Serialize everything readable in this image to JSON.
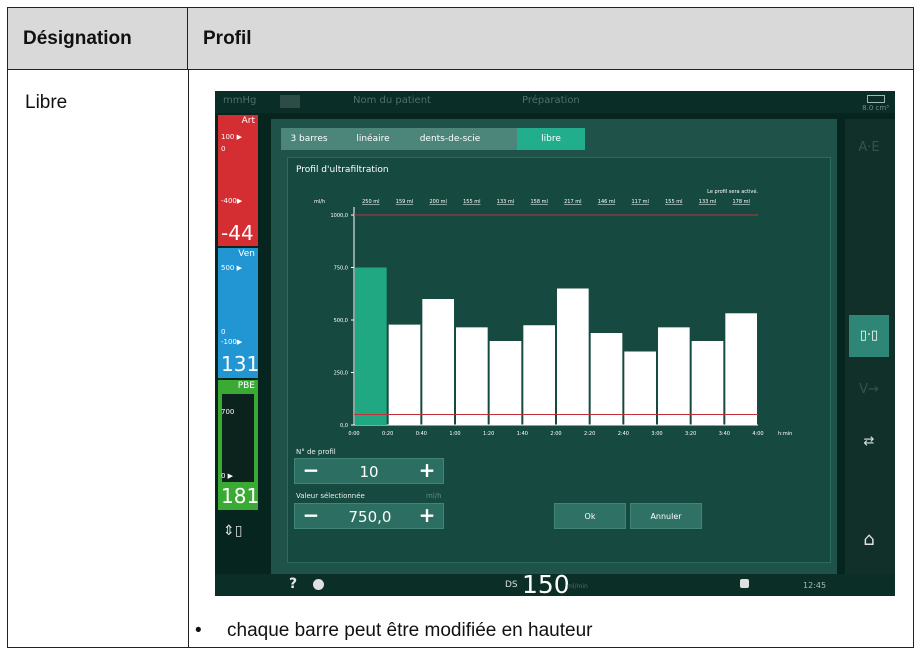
{
  "table": {
    "header_left": "Désignation",
    "header_right": "Profil",
    "row_label": "Libre",
    "bullet_text": "chaque barre peut être modifiée en hauteur"
  },
  "topbar": {
    "left_text": "mmHg",
    "patient": "Nom du patient",
    "mode": "Préparation",
    "battery_value": "8.0 cm³"
  },
  "pressures": {
    "art": {
      "label": "Art",
      "top": "100 ▶",
      "zero": "0",
      "low": "-400▶",
      "value": "-44",
      "color": "#d42e33"
    },
    "ven": {
      "label": "Ven",
      "top": "500 ▶",
      "zero": "0",
      "low": "-100▶",
      "value": "131",
      "color": "#2196d3"
    },
    "pbe": {
      "label": "PBE",
      "top": "700",
      "low": "0   ▶",
      "value": "181",
      "color": "#3aaa35"
    }
  },
  "tabs": [
    {
      "label": "3 barres",
      "selected": false
    },
    {
      "label": "linéaire",
      "selected": false
    },
    {
      "label": "dents-de-scie",
      "selected": false
    },
    {
      "label": "libre",
      "selected": true
    }
  ],
  "panel": {
    "title": "Profil d'ultrafiltration",
    "activated_note": "Le profil sera activé.",
    "unit_rate": "ml/h",
    "unit_time": "h:min"
  },
  "chart_data": {
    "type": "bar",
    "x": [
      "0:00",
      "0:20",
      "0:40",
      "1:00",
      "1:20",
      "1:40",
      "2:00",
      "2:20",
      "2:40",
      "3:00",
      "3:20",
      "3:40",
      "4:00"
    ],
    "volumes": [
      "250 ml",
      "159 ml",
      "200 ml",
      "155 ml",
      "133 ml",
      "158 ml",
      "217 ml",
      "146 ml",
      "117 ml",
      "155 ml",
      "133 ml",
      "178 ml"
    ],
    "values": [
      750,
      478,
      600,
      465,
      400,
      475,
      650,
      438,
      350,
      465,
      400,
      532
    ],
    "selected_index": 0,
    "ylim": [
      0,
      1000
    ],
    "yticks": [
      "0,0",
      "250,0",
      "500,0",
      "750,0",
      "1000,0"
    ],
    "upper_limit": 1000,
    "lower_limit": 50,
    "colors": {
      "selected": "#1fa882",
      "bar": "#ffffff",
      "limit": "#c2303a"
    }
  },
  "controls": {
    "profile_label": "N° de profil",
    "profile_value": "10",
    "value_label": "Valeur sélectionnée",
    "value_unit": "ml/h",
    "selected_value": "750,0",
    "minus": "−",
    "plus": "+",
    "ok": "Ok",
    "cancel": "Annuler"
  },
  "bottombar": {
    "help": "?",
    "ds_label": "DS",
    "ds_value": "150",
    "ds_unit": "ml/min",
    "time": "12:45"
  },
  "icons": [
    "arrow-icon",
    "heparin-syringe-icon",
    "flow-direction-icon",
    "patient-connect-icon",
    "home-icon",
    "syringe-icon",
    "lock-icon",
    "clock-icon"
  ]
}
